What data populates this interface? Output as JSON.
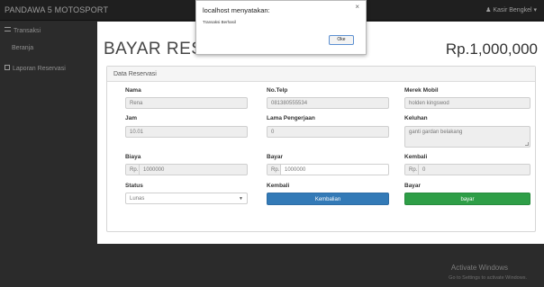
{
  "navbar": {
    "brand": "PANDAWA 5 MOTOSPORT",
    "user": "♟ Kasir Bengkel ▾"
  },
  "sidebar": {
    "items": [
      {
        "label": "Transaksi",
        "icon": "menu-icon"
      },
      {
        "label": "Beranja",
        "icon": ""
      },
      {
        "label": "Laporan Reservasi",
        "icon": "table-icon"
      }
    ]
  },
  "page": {
    "title": "BAYAR RESE",
    "total": "Rp.1,000,000"
  },
  "panel": {
    "heading": "Data Reservasi"
  },
  "form": {
    "nama": {
      "label": "Nama",
      "value": "Rena"
    },
    "no_telp": {
      "label": "No.Telp",
      "value": "081380555534"
    },
    "merek": {
      "label": "Merek Mobil",
      "value": "holden kingswod"
    },
    "jam": {
      "label": "Jam",
      "value": "10.01"
    },
    "lama": {
      "label": "Lama Pengerjaan",
      "value": "0"
    },
    "keluhan": {
      "label": "Keluhan",
      "value": "ganti gardan belakang"
    },
    "biaya": {
      "label": "Biaya",
      "prefix": "Rp.",
      "value": "1000000"
    },
    "bayar": {
      "label": "Bayar",
      "prefix": "Rp.",
      "value": "1000000"
    },
    "kembali": {
      "label": "Kembali",
      "prefix": "Rp.",
      "value": "0"
    },
    "status": {
      "label": "Status",
      "value": "Lunas"
    },
    "kembali_btn": {
      "label": "Kembali",
      "button": "Kembalian"
    },
    "bayar_btn": {
      "label": "Bayar",
      "button": "bayar"
    }
  },
  "dialog": {
    "title": "localhost menyatakan:",
    "message": "Transaksi Berhasil",
    "ok": "Oke",
    "close": "×"
  },
  "watermark": {
    "line1": "Activate Windows",
    "line2": "Go to Settings to activate Windows."
  },
  "colors": {
    "primary": "#337ab7",
    "success": "#2e9e47",
    "navbar": "#1f1f1f"
  }
}
